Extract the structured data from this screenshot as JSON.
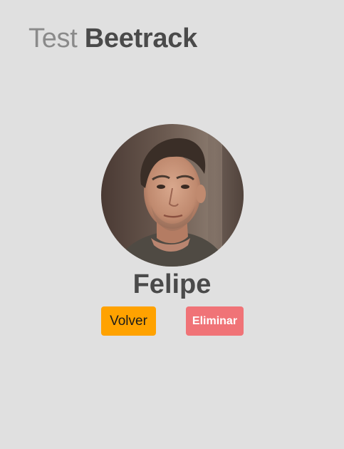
{
  "header": {
    "title_light": "Test",
    "title_bold": "Beetrack"
  },
  "profile": {
    "name": "Felipe",
    "avatar_icon": "user-photo"
  },
  "actions": {
    "back_label": "Volver",
    "delete_label": "Eliminar",
    "back_color": "#ffa200",
    "delete_color": "#f07377"
  },
  "colors": {
    "background": "#e0e0e0",
    "text_dark": "#4a4a4a",
    "text_light": "#8a8a8a"
  }
}
